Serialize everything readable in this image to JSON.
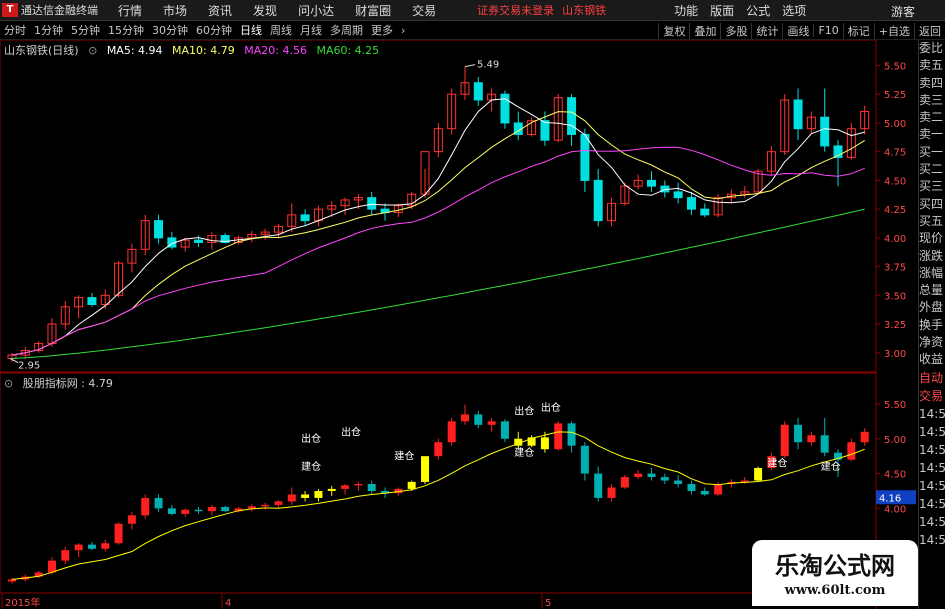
{
  "app": {
    "name": "通达信金融终端",
    "menu": [
      "行情",
      "市场",
      "资讯",
      "发现",
      "问小达",
      "财富圈",
      "交易"
    ],
    "notice": "证券交易未登录",
    "notice_stock": "山东钢铁",
    "right_menu": [
      "功能",
      "版面",
      "公式",
      "选项"
    ],
    "guest": "游客"
  },
  "periods": {
    "items": [
      "分时",
      "1分钟",
      "5分钟",
      "15分钟",
      "30分钟",
      "60分钟",
      "日线",
      "周线",
      "月线",
      "多周期",
      "更多"
    ],
    "active": "日线",
    "right_buttons": [
      "复权",
      "叠加",
      "多股",
      "统计",
      "画线",
      "F10",
      "标记",
      "+自选",
      "返回"
    ]
  },
  "main_chart": {
    "title": "山东钢铁(日线)",
    "ma": [
      {
        "label": "MA5: 4.94",
        "color": "#ffffff"
      },
      {
        "label": "MA10: 4.79",
        "color": "#ffff66"
      },
      {
        "label": "MA20: 4.56",
        "color": "#ff44ff"
      },
      {
        "label": "MA60: 4.25",
        "color": "#33dd33"
      }
    ],
    "high_label": "5.49",
    "low_label": "2.95",
    "yaxis_ticks": [
      "5.50",
      "5.25",
      "5.00",
      "4.75",
      "4.50",
      "4.25",
      "4.00",
      "3.75",
      "3.50",
      "3.25",
      "3.00"
    ]
  },
  "sub_chart": {
    "title": "股朋指标网 : 4.79",
    "yaxis_ticks": [
      "5.50",
      "5.00",
      "4.50",
      "4.00",
      "3.50",
      "3.00"
    ],
    "current_value": "4.16",
    "annotations": [
      "出仓",
      "建仓",
      "出仓",
      "建仓",
      "出仓",
      "建仓",
      "出仓",
      "建仓",
      "建仓"
    ]
  },
  "xaxis": {
    "labels": [
      "2015年",
      "4",
      "5"
    ]
  },
  "side_panel": {
    "items": [
      "委比",
      "卖五",
      "卖四",
      "卖三",
      "卖二",
      "卖一",
      "买一",
      "买二",
      "买三",
      "买四",
      "买五",
      "现价",
      "涨跌",
      "涨幅",
      "总量",
      "外盘",
      "换手",
      "净资",
      "收益",
      "自动",
      "交易",
      "14:56",
      "14:56",
      "14:56",
      "14:56",
      "14:56",
      "14:56",
      "14:56",
      "14:56"
    ]
  },
  "watermark": {
    "line1": "乐淘公式网",
    "line2": "www.60lt.com"
  },
  "chart_data": {
    "type": "candlestick",
    "title": "山东钢铁(日线)",
    "ylim": [
      2.85,
      5.6
    ],
    "candles": [
      [
        2.95,
        3.0,
        2.92,
        2.98
      ],
      [
        2.98,
        3.05,
        2.95,
        3.02
      ],
      [
        3.02,
        3.1,
        3.0,
        3.08
      ],
      [
        3.08,
        3.3,
        3.05,
        3.25
      ],
      [
        3.25,
        3.45,
        3.2,
        3.4
      ],
      [
        3.4,
        3.5,
        3.3,
        3.48
      ],
      [
        3.48,
        3.52,
        3.4,
        3.42
      ],
      [
        3.42,
        3.55,
        3.38,
        3.5
      ],
      [
        3.5,
        3.8,
        3.48,
        3.78
      ],
      [
        3.78,
        3.95,
        3.7,
        3.9
      ],
      [
        3.9,
        4.2,
        3.85,
        4.15
      ],
      [
        4.15,
        4.2,
        3.95,
        4.0
      ],
      [
        4.0,
        4.05,
        3.9,
        3.92
      ],
      [
        3.92,
        4.0,
        3.88,
        3.98
      ],
      [
        3.98,
        4.02,
        3.92,
        3.96
      ],
      [
        3.96,
        4.05,
        3.9,
        4.02
      ],
      [
        4.02,
        4.04,
        3.95,
        3.96
      ],
      [
        3.96,
        4.02,
        3.94,
        4.0
      ],
      [
        4.0,
        4.06,
        3.96,
        4.03
      ],
      [
        4.03,
        4.08,
        3.98,
        4.05
      ],
      [
        4.05,
        4.12,
        4.0,
        4.1
      ],
      [
        4.1,
        4.3,
        4.05,
        4.2
      ],
      [
        4.2,
        4.25,
        4.1,
        4.15
      ],
      [
        4.15,
        4.28,
        4.1,
        4.25
      ],
      [
        4.25,
        4.32,
        4.18,
        4.28
      ],
      [
        4.28,
        4.35,
        4.2,
        4.33
      ],
      [
        4.33,
        4.38,
        4.25,
        4.35
      ],
      [
        4.35,
        4.4,
        4.2,
        4.25
      ],
      [
        4.25,
        4.3,
        4.15,
        4.22
      ],
      [
        4.22,
        4.3,
        4.18,
        4.28
      ],
      [
        4.28,
        4.4,
        4.25,
        4.38
      ],
      [
        4.38,
        4.6,
        4.35,
        4.75
      ],
      [
        4.75,
        5.0,
        4.7,
        4.95
      ],
      [
        4.95,
        5.3,
        4.9,
        5.25
      ],
      [
        5.25,
        5.49,
        5.2,
        5.35
      ],
      [
        5.35,
        5.4,
        5.15,
        5.2
      ],
      [
        5.2,
        5.3,
        5.1,
        5.25
      ],
      [
        5.25,
        5.28,
        4.95,
        5.0
      ],
      [
        5.0,
        5.1,
        4.85,
        4.9
      ],
      [
        4.9,
        5.05,
        4.88,
        5.02
      ],
      [
        5.02,
        5.1,
        4.8,
        4.85
      ],
      [
        4.85,
        5.25,
        4.83,
        5.22
      ],
      [
        5.22,
        5.25,
        4.8,
        4.9
      ],
      [
        4.9,
        4.95,
        4.4,
        4.5
      ],
      [
        4.5,
        4.6,
        4.1,
        4.15
      ],
      [
        4.15,
        4.35,
        4.1,
        4.3
      ],
      [
        4.3,
        4.48,
        4.28,
        4.45
      ],
      [
        4.45,
        4.55,
        4.42,
        4.5
      ],
      [
        4.5,
        4.58,
        4.4,
        4.45
      ],
      [
        4.45,
        4.5,
        4.35,
        4.4
      ],
      [
        4.4,
        4.48,
        4.3,
        4.35
      ],
      [
        4.35,
        4.4,
        4.2,
        4.25
      ],
      [
        4.25,
        4.3,
        4.18,
        4.2
      ],
      [
        4.2,
        4.38,
        4.18,
        4.35
      ],
      [
        4.35,
        4.42,
        4.3,
        4.38
      ],
      [
        4.38,
        4.45,
        4.35,
        4.4
      ],
      [
        4.4,
        4.6,
        4.38,
        4.58
      ],
      [
        4.58,
        4.8,
        4.55,
        4.75
      ],
      [
        4.75,
        5.25,
        4.72,
        5.2
      ],
      [
        5.2,
        5.3,
        4.85,
        4.95
      ],
      [
        4.95,
        5.1,
        4.9,
        5.05
      ],
      [
        5.05,
        5.3,
        4.75,
        4.8
      ],
      [
        4.8,
        4.85,
        4.45,
        4.7
      ],
      [
        4.7,
        5.0,
        4.68,
        4.95
      ],
      [
        4.95,
        5.15,
        4.9,
        5.1
      ]
    ]
  }
}
